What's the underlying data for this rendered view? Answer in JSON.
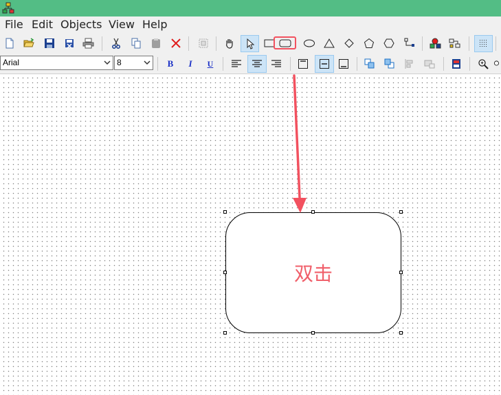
{
  "menu": {
    "items": [
      "File",
      "Edit",
      "Objects",
      "View",
      "Help"
    ]
  },
  "font": {
    "name": "Arial",
    "size": "8"
  },
  "format": {
    "bold": "B",
    "italic": "I",
    "underline": "U"
  },
  "shape": {
    "label": "双击"
  },
  "colors": {
    "titlebar": "#53bd85",
    "selected_tool": "#cce4f7",
    "annotation": "#f2515f",
    "label": "#f05f6a"
  }
}
